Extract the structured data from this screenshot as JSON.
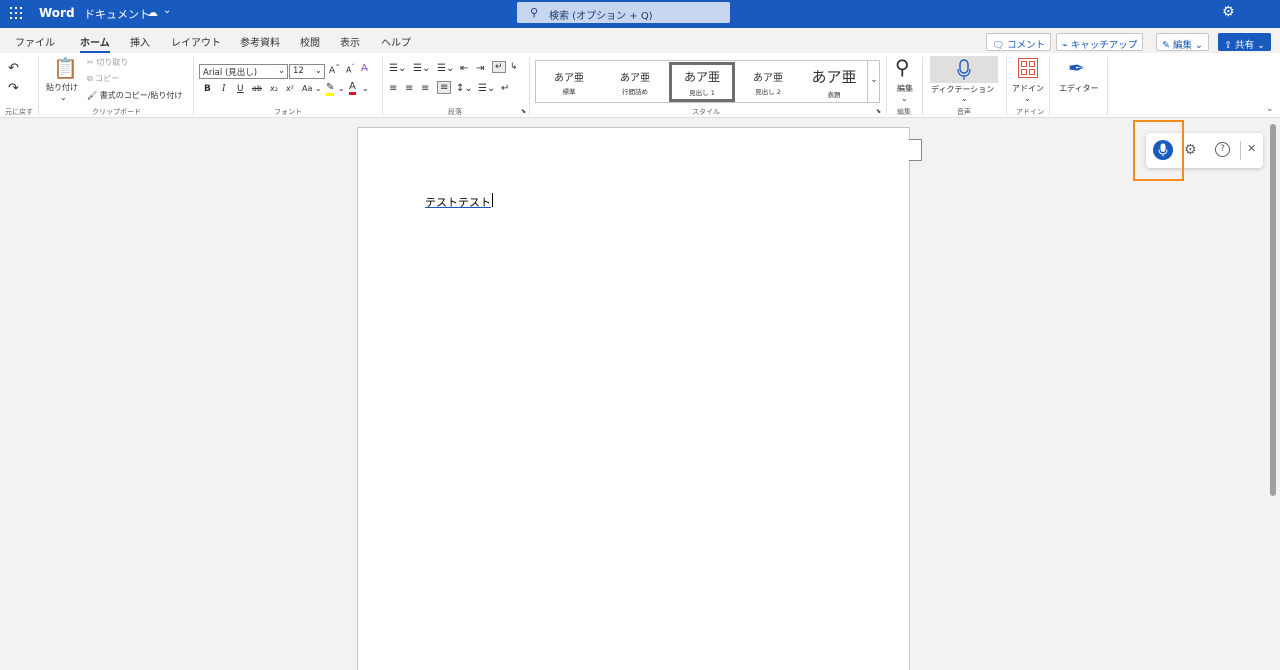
{
  "titlebar": {
    "app_name": "Word",
    "doc_name": "ドキュメント",
    "search_placeholder": "検索 (オプション + Q)"
  },
  "tabs": [
    "ファイル",
    "ホーム",
    "挿入",
    "レイアウト",
    "参考資料",
    "校閲",
    "表示",
    "ヘルプ"
  ],
  "active_tab": "ホーム",
  "commands": {
    "comment": "コメント",
    "catchup": "キャッチアップ",
    "edit": "編集",
    "share": "共有"
  },
  "ribbon": {
    "undo_label": "元に戻す",
    "paste_label": "貼り付け",
    "cut_label": "切り取り",
    "copy_label": "コピー",
    "format_painter_label": "書式のコピー/貼り付け",
    "clipboard_group": "クリップボード",
    "font_name": "Arial (見出し)",
    "font_size": "12",
    "font_group": "フォント",
    "paragraph_group": "段落",
    "styles": [
      {
        "sample": "あア亜",
        "name": "標準"
      },
      {
        "sample": "あア亜",
        "name": "行間詰め"
      },
      {
        "sample": "あア亜",
        "name": "見出し 1"
      },
      {
        "sample": "あア亜",
        "name": "見出し 2"
      },
      {
        "sample": "あア亜",
        "name": "表題"
      }
    ],
    "styles_group": "スタイル",
    "editing_label": "編集",
    "editing_group": "編集",
    "dictation_label": "ディクテーション",
    "voice_group": "音声",
    "addins_label": "アドイン",
    "addins_group": "アドイン",
    "editor_label": "エディター",
    "font_buttons": {
      "bold": "B",
      "italic": "I",
      "underline": "U",
      "strike": "ab",
      "sub": "x₂",
      "sup": "x²",
      "case": "Aa",
      "grow": "A^",
      "shrink": "Aˇ"
    }
  },
  "document": {
    "text": "テストテスト"
  },
  "colors": {
    "brand": "#185abd",
    "highlight": "#f08c1e"
  }
}
